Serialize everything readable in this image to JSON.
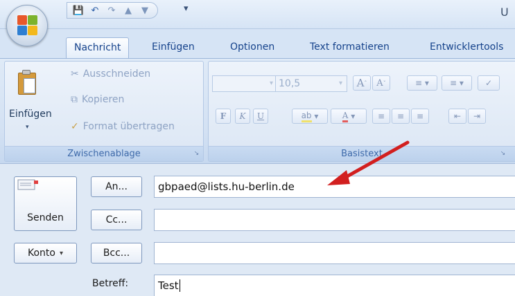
{
  "title_bar": {
    "title_fragment": "U"
  },
  "quick_access": [
    "save-icon",
    "undo-icon",
    "redo-icon",
    "arrow-up-icon",
    "arrow-down-icon",
    "customize-qat-icon"
  ],
  "tabs": [
    {
      "label": "Nachricht",
      "active": true
    },
    {
      "label": "Einfügen"
    },
    {
      "label": "Optionen"
    },
    {
      "label": "Text formatieren"
    },
    {
      "label": "Entwicklertools"
    }
  ],
  "clipboard": {
    "group_label": "Zwischenablage",
    "paste_label": "Einfügen",
    "cut_label": "Ausschneiden",
    "copy_label": "Kopieren",
    "format_painter_label": "Format übertragen"
  },
  "basictext": {
    "group_label": "Basistext",
    "font_name": "",
    "font_size": "10,5"
  },
  "compose": {
    "send_label": "Senden",
    "account_label": "Konto",
    "to_button": "An...",
    "cc_button": "Cc...",
    "bcc_button": "Bcc...",
    "subject_label": "Betreff:",
    "to_value": "gbpaed@lists.hu-berlin.de",
    "cc_value": "",
    "bcc_value": "",
    "subject_value": "Test"
  },
  "colors": {
    "annotation_arrow": "#d21f1f",
    "ribbon": "#d6e4f5",
    "tab_text": "#15428b"
  }
}
